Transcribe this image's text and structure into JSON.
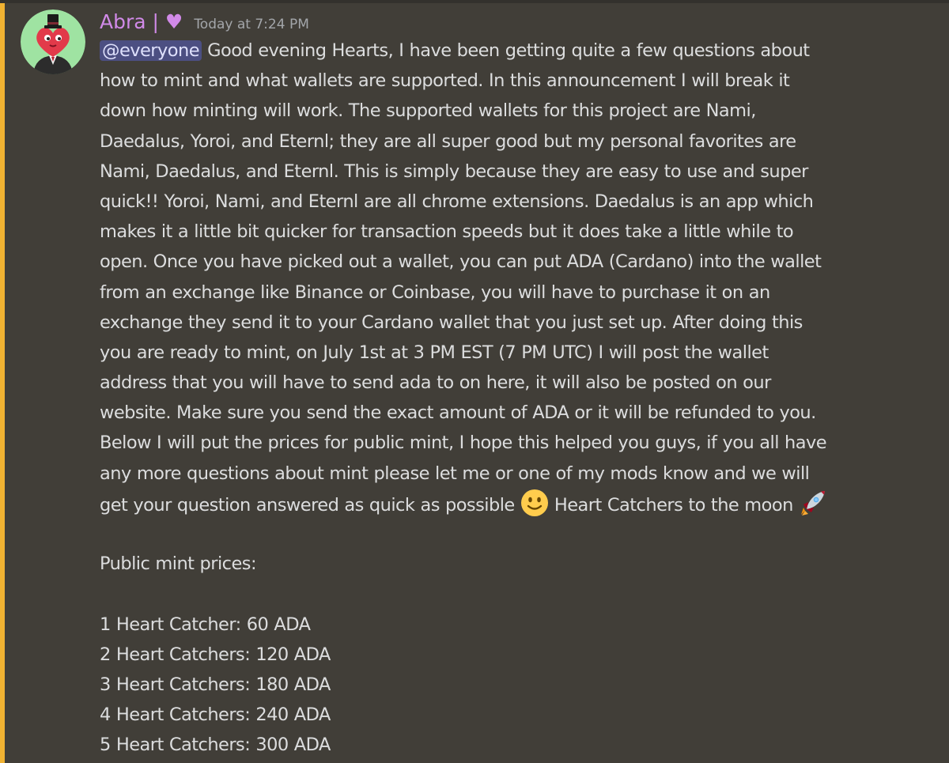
{
  "message": {
    "author": {
      "name": "Abra | ♥",
      "name_color": "#d18ae8"
    },
    "timestamp": "Today at 7:24 PM",
    "mention": "@everyone",
    "lines": [
      " Good evening Hearts, I have been getting quite a few questions about",
      "how to mint and what wallets are supported. In this announcement I will break it",
      "down how minting will work. The supported wallets for this project are Nami,",
      "Daedalus, Yoroi, and Eternl; they are all super good but my personal favorites are",
      "Nami, Daedalus, and Eternl. This is simply because they are easy to use and super",
      "quick!! Yoroi, Nami, and Eternl are all chrome extensions. Daedalus is an app which",
      "makes it a little bit quicker for transaction speeds but it does take a little while to",
      "open. Once you have picked out a wallet, you can put ADA (Cardano) into the wallet",
      "from an exchange like Binance or Coinbase, you will have to purchase it on an",
      "exchange they send it to your Cardano wallet that you just set up. After doing this",
      "you are ready to mint, on July 1st at 3 PM EST (7 PM UTC) I will post the wallet",
      "address that you will have to send ada to on here, it will also be posted on our",
      "website. Make sure you send the exact amount of ADA or it will be refunded to you.",
      "Below I will put the prices for public mint, I hope this helped you guys, if you all have",
      "any more questions about mint please let me or one of my mods know and we will"
    ],
    "last_line": {
      "before_emoji": "get your question answered as quick as possible ",
      "between_emoji": " Heart Catchers to the moon ",
      "emoji_1": "slightly-smiling-face-icon",
      "emoji_2": "rocket-icon"
    },
    "prices_heading": "Public mint prices:",
    "prices": [
      "1 Heart Catcher: 60 ADA",
      "2 Heart Catchers: 120 ADA",
      "3 Heart Catchers: 180 ADA",
      "4 Heart Catchers: 240 ADA",
      "5 Heart Catchers: 300 ADA"
    ]
  },
  "colors": {
    "background": "#413e38",
    "mention_highlight_bar": "#f0b232",
    "mention_pill": "#4c4f82",
    "text": "#dcddde",
    "timestamp": "#a3a6aa"
  }
}
